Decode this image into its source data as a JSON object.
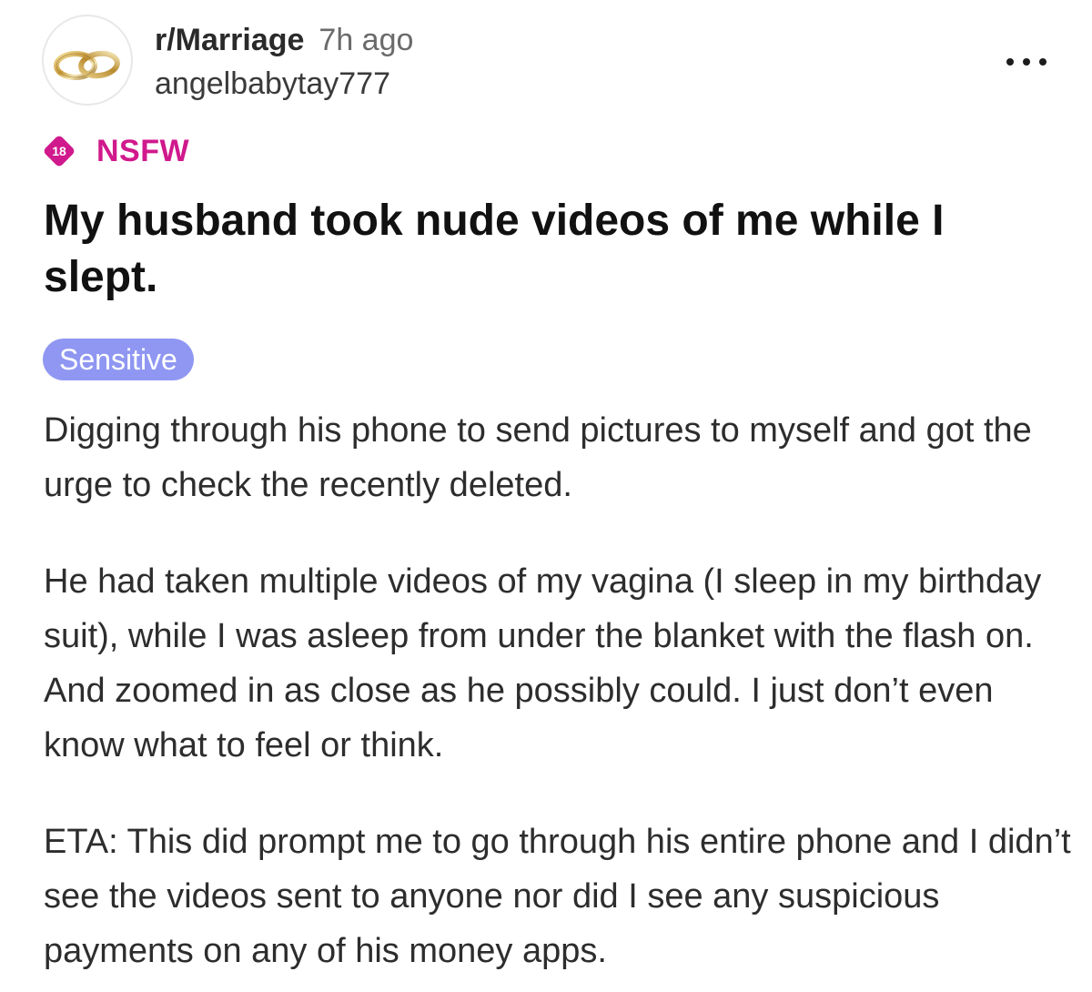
{
  "header": {
    "subreddit": "r/Marriage",
    "timestamp": "7h ago",
    "username": "angelbabytay777",
    "avatar_icon": "wedding-rings-icon",
    "more_icon": "more-dots-icon"
  },
  "nsfw": {
    "badge_text": "18",
    "label": "NSFW",
    "color": "#d0198c"
  },
  "post": {
    "title": "My husband took nude videos of me while I slept.",
    "flair": "Sensitive",
    "flair_color": "#8f97f2",
    "paragraphs": [
      "Digging through his phone to send pictures to myself and got the urge to check the recently deleted.",
      "He had taken multiple videos of my vagina (I sleep in my birthday suit), while I was asleep from under the blanket with the flash on. And zoomed in as close as he possibly could. I just don’t even know what to feel or think.",
      "ETA: This did prompt me to go through his entire phone and I didn’t see the videos sent to anyone nor did I see any suspicious payments on any of his money apps."
    ]
  }
}
